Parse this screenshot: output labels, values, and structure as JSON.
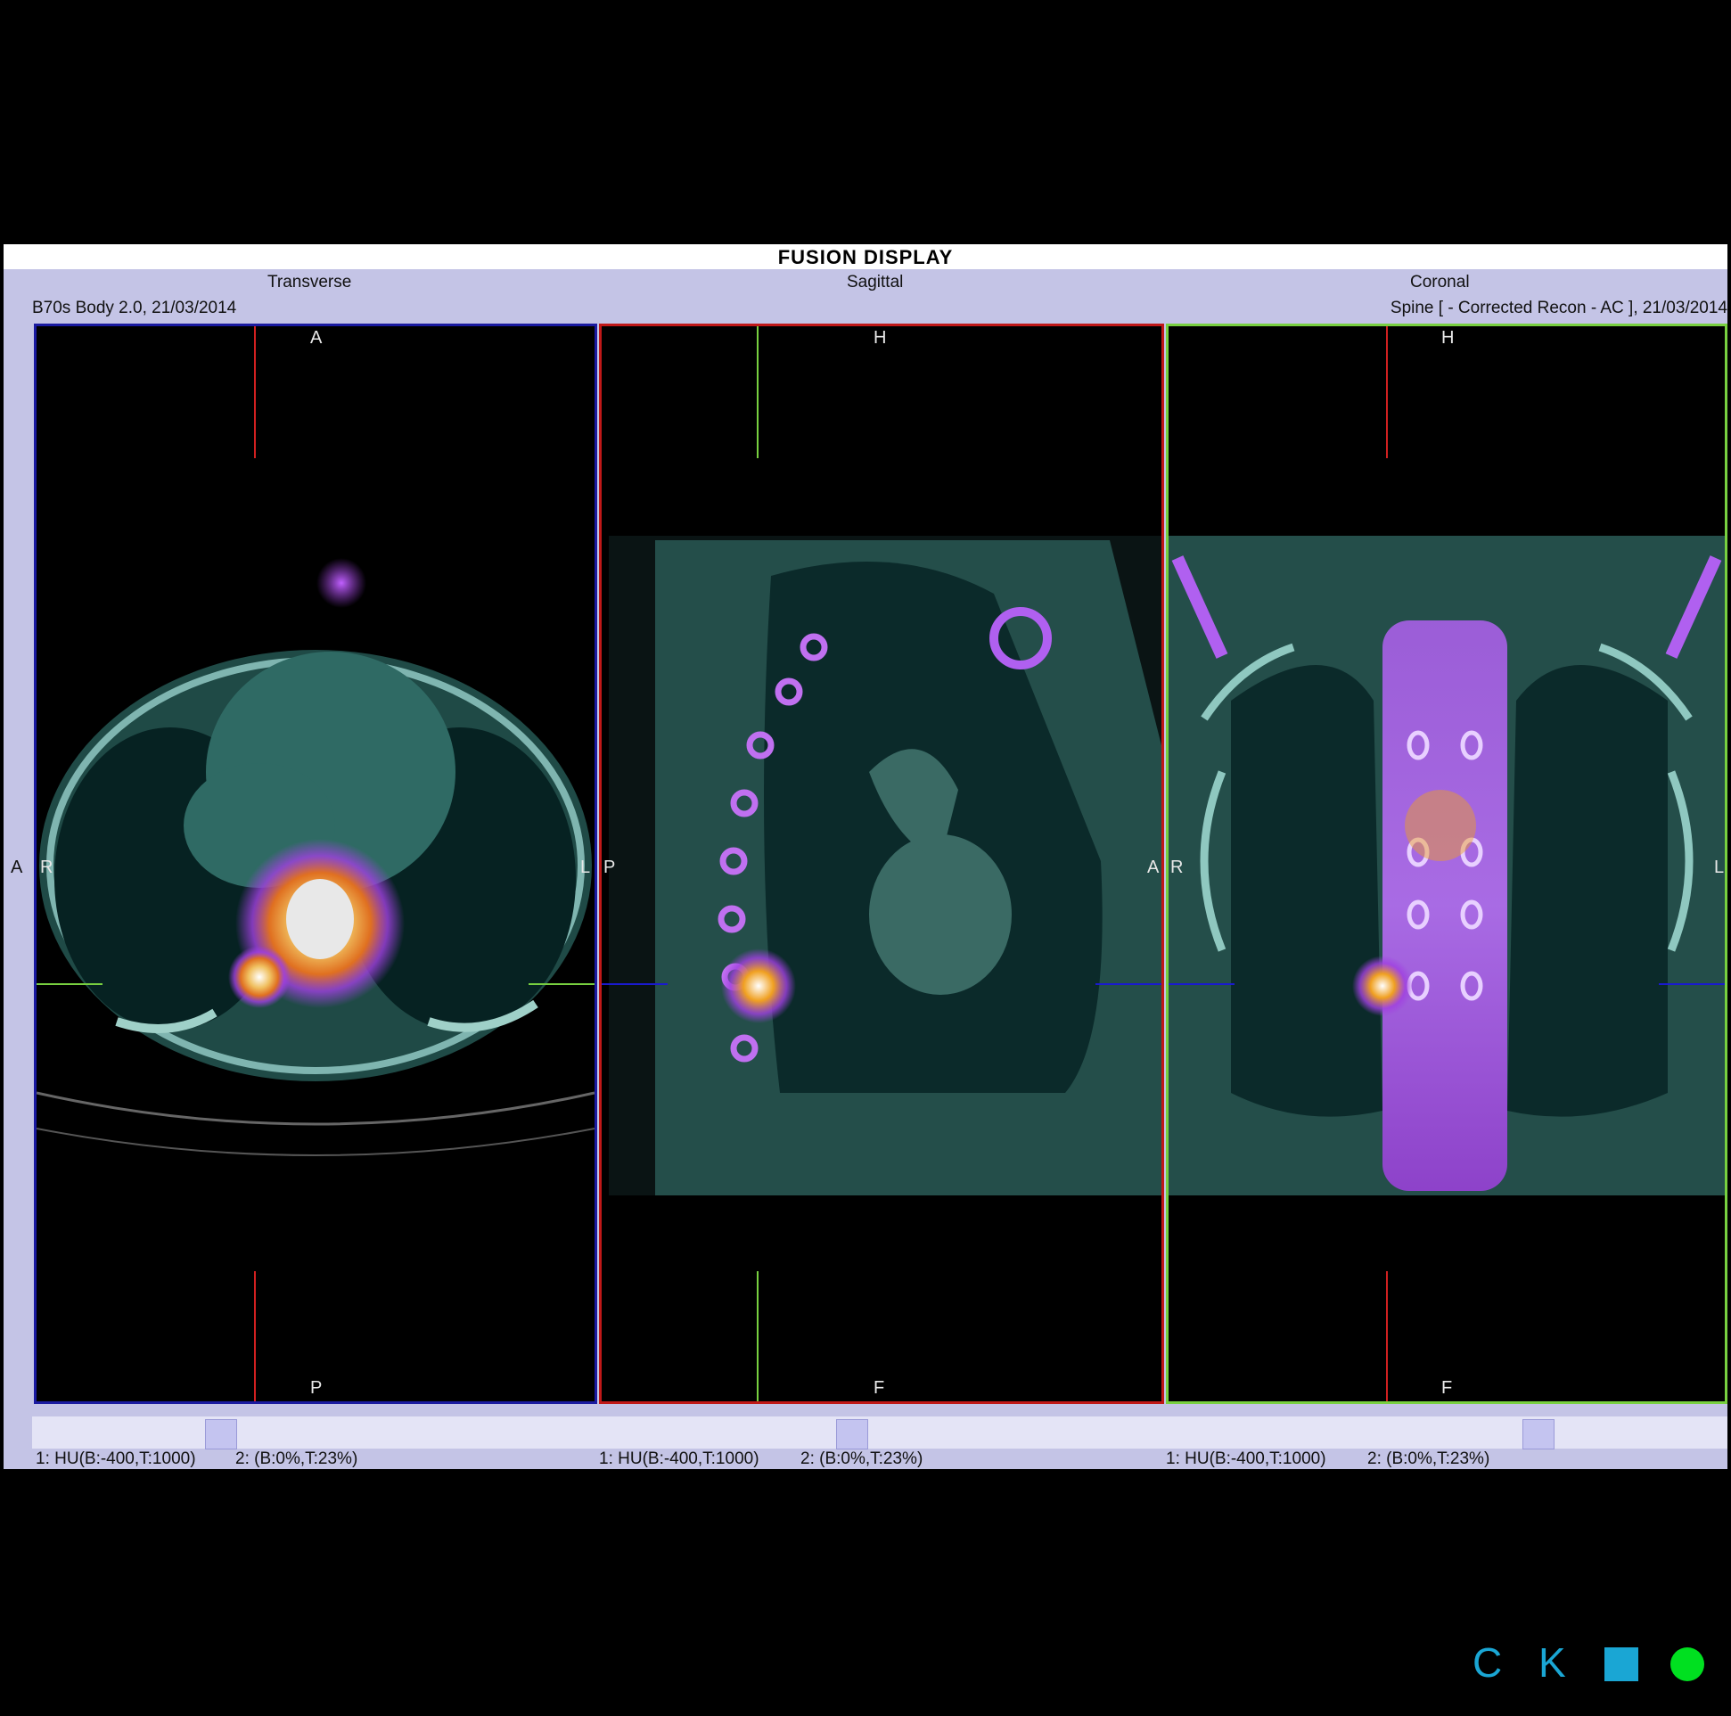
{
  "window": {
    "title": "FUSION DISPLAY"
  },
  "views": {
    "transverse": {
      "label": "Transverse",
      "series": "B70s Body  2.0, 21/03/2014",
      "orient": {
        "top": "A",
        "bottom": "P",
        "left": "R",
        "right": "L",
        "outer_left": "A"
      },
      "window_level": {
        "ct": "1: HU(B:-400,T:1000)",
        "pet": "2: (B:0%,T:23%)"
      }
    },
    "sagittal": {
      "label": "Sagittal",
      "orient": {
        "top": "H",
        "bottom": "F",
        "left": "P",
        "right": "A"
      },
      "window_level": {
        "ct": "1: HU(B:-400,T:1000)",
        "pet": "2: (B:0%,T:23%)"
      }
    },
    "coronal": {
      "label": "Coronal",
      "series": "Spine [ - Corrected Recon - AC ], 21/03/2014",
      "orient": {
        "top": "H",
        "bottom": "F",
        "left": "R",
        "right": "L"
      },
      "window_level": {
        "ct": "1: HU(B:-400,T:1000)",
        "pet": "2: (B:0%,T:23%)"
      }
    }
  },
  "colors": {
    "transverse_frame": "#1a1aa0",
    "sagittal_frame": "#c01818",
    "coronal_frame": "#78d040",
    "ct_tint": "#3a8a80",
    "pet_hot": "#f0a020",
    "pet_mid": "#a040e0",
    "logo_c": "#1aa6d4",
    "logo_square": "#1aa6d4",
    "logo_dot": "#00e020"
  },
  "logo": {
    "c": "C",
    "k": "K",
    "square_icon": "square-icon",
    "dot_icon": "dot-icon"
  }
}
